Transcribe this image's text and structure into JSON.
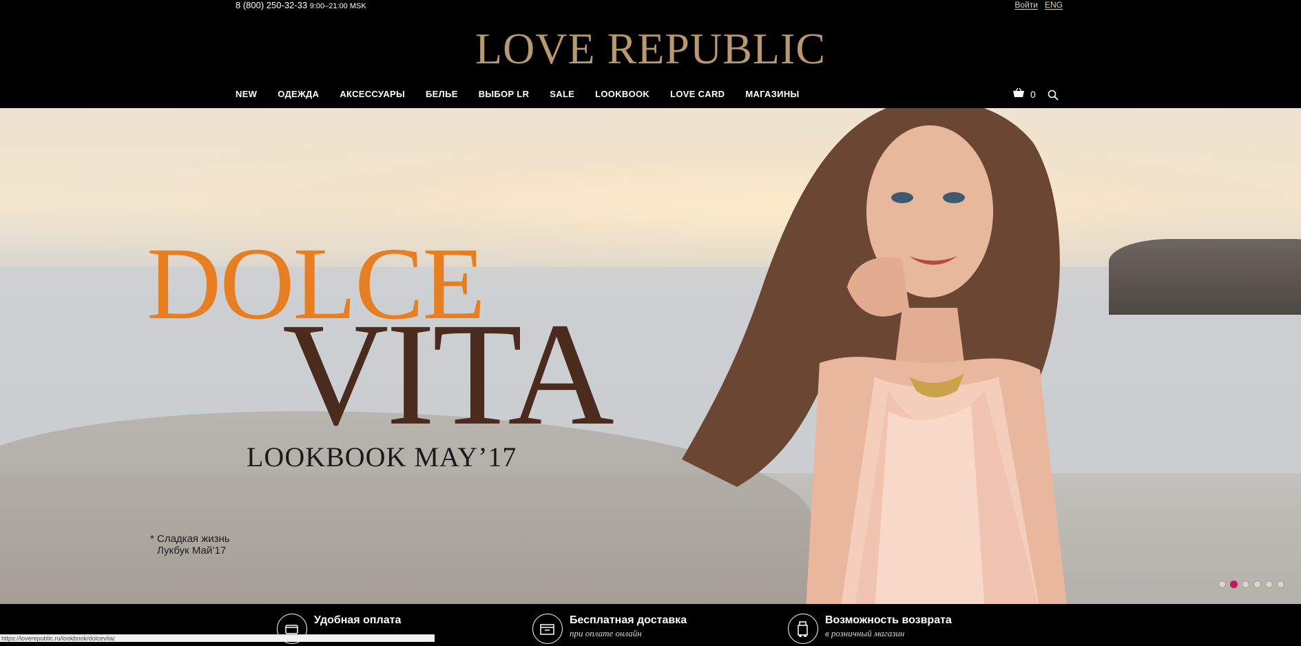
{
  "header": {
    "phone": "8 (800) 250-32-33",
    "hours": "9:00–21:00 MSK",
    "login": "Войти",
    "lang": "ENG",
    "logo": "LOVE REPUBLIC",
    "cart_count": "0"
  },
  "nav": [
    {
      "label": "NEW"
    },
    {
      "label": "ОДЕЖДА"
    },
    {
      "label": "АКСЕССУАРЫ"
    },
    {
      "label": "БЕЛЬЕ"
    },
    {
      "label": "ВЫБОР LR"
    },
    {
      "label": "SALE"
    },
    {
      "label": "LOOKBOOK"
    },
    {
      "label": "LOVE CARD"
    },
    {
      "label": "МАГАЗИНЫ"
    }
  ],
  "hero": {
    "title1": "DOLCE",
    "title2": "VITA",
    "subtitle": "LOOKBOOK MAY’17",
    "note_line1": "* Сладкая жизнь",
    "note_line2": "Лукбук Май’17",
    "slides_total": 6,
    "slide_active": 2
  },
  "features": [
    {
      "title": "Удобная оплата",
      "sub": "",
      "icon": "wallet-icon"
    },
    {
      "title": "Бесплатная доставка",
      "sub": "при оплате онлайн",
      "icon": "box-icon"
    },
    {
      "title": "Возможность возврата",
      "sub": "в розничный магазин",
      "icon": "return-icon"
    }
  ],
  "status_url": "https://loverepublic.ru/lookbook/dolcevita/",
  "colors": {
    "accent_gold": "#b8986e",
    "dolce_orange": "#e87e22",
    "vita_brown": "#4a2b1d",
    "dot_active": "#c2185b"
  }
}
